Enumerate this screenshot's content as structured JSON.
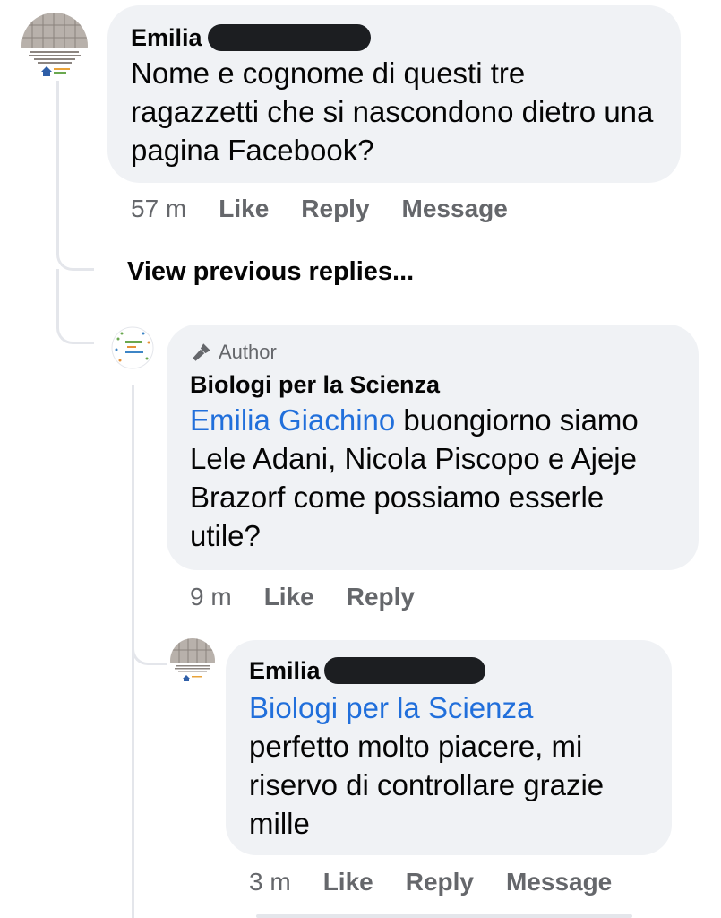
{
  "comment1": {
    "name": "Emilia",
    "text": "Nome e cognome di questi tre ragazzetti che si nascondono dietro una pagina Facebook?",
    "time": "57 m",
    "actions": [
      "Like",
      "Reply",
      "Message"
    ]
  },
  "view_previous": "View previous replies...",
  "reply1": {
    "badge": "Author",
    "name": "Biologi per la Scienza",
    "mention": "Emilia Giachino",
    "text": " buongiorno siamo Lele Adani, Nicola Piscopo e Ajeje Brazorf come possiamo esserle utile?",
    "time": "9 m",
    "actions": [
      "Like",
      "Reply"
    ]
  },
  "reply2": {
    "name": "Emilia",
    "mention": "Biologi per la Scienza",
    "text": "perfetto molto piacere, mi riservo di controllare grazie mille",
    "time": "3 m",
    "actions": [
      "Like",
      "Reply",
      "Message"
    ]
  },
  "colors": {
    "bubble": "#f0f2f5",
    "mention": "#216fdb",
    "meta": "#65676b",
    "redaction": "#1c1e21"
  },
  "icons": {
    "author_badge": "microphone-icon"
  }
}
